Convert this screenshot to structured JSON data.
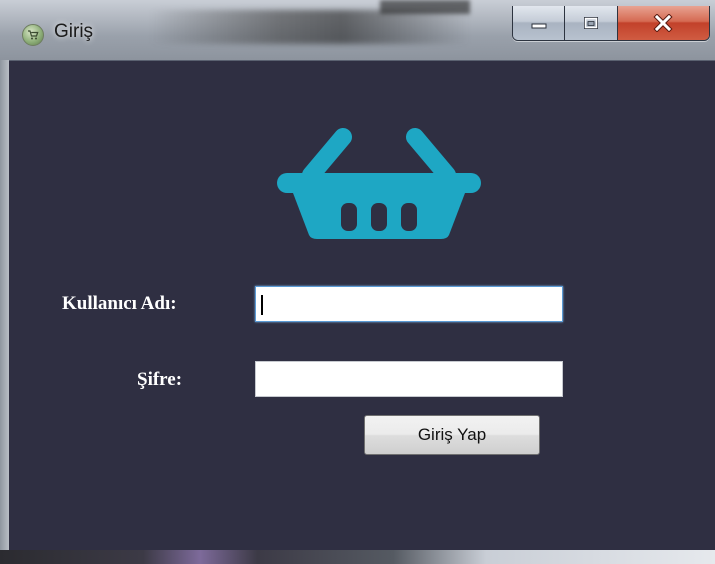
{
  "window": {
    "title": "Giriş",
    "app_icon": "shopping-cart-icon",
    "controls": {
      "minimize_icon": "minimize-icon",
      "maximize_icon": "maximize-icon",
      "close_icon": "close-icon"
    }
  },
  "form": {
    "logo_icon": "shopping-basket-icon",
    "username_label": "Kullanıcı Adı:",
    "username_value": "",
    "password_label": "Şifre:",
    "password_value": "",
    "submit_label": "Giriş Yap"
  },
  "colors": {
    "background": "#2f2f42",
    "basket": "#1ea7c4",
    "label_text": "#ffffff"
  }
}
